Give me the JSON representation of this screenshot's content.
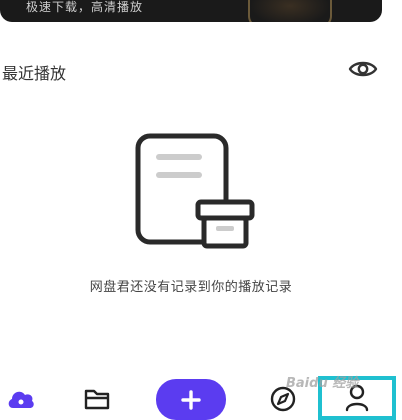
{
  "banner": {
    "text": "极速下载，高清播放"
  },
  "recent": {
    "title": "最近播放",
    "toggle_icon": "eye-icon"
  },
  "empty_state": {
    "icon": "document-box-icon",
    "message": "网盘君还没有记录到你的播放记录"
  },
  "bottom_nav": {
    "items": [
      {
        "id": "home",
        "icon": "cloud-icon",
        "active": true
      },
      {
        "id": "files",
        "icon": "folder-icon"
      },
      {
        "id": "add",
        "icon": "plus-icon"
      },
      {
        "id": "discover",
        "icon": "compass-icon"
      },
      {
        "id": "profile",
        "icon": "user-icon",
        "highlighted": true
      }
    ]
  },
  "colors": {
    "accent": "#5b3cf0",
    "highlight_border": "#1fc0d0",
    "text_primary": "#333333",
    "icon_dark": "#222222",
    "placeholder_line": "#cccccc"
  },
  "watermark": {
    "text": "Baidu 经验"
  }
}
